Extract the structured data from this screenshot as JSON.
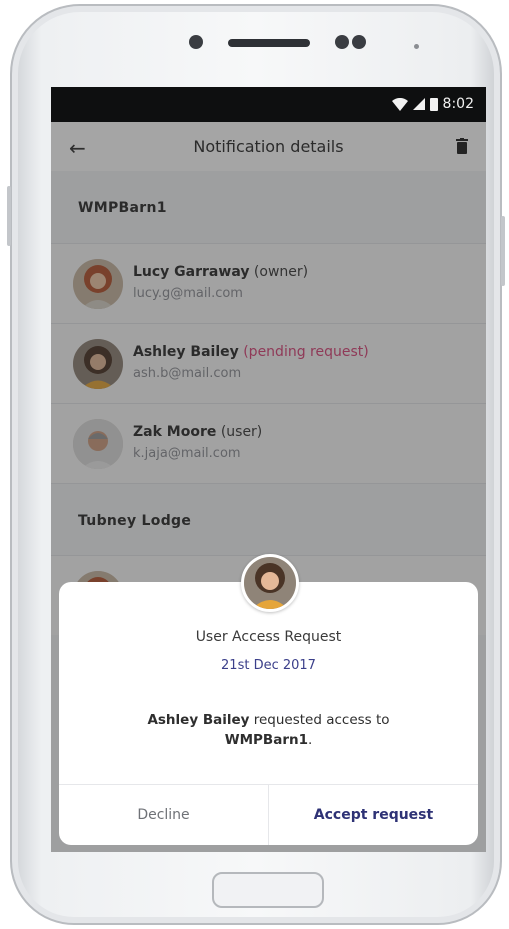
{
  "statusbar": {
    "time": "8:02"
  },
  "appbar": {
    "title": "Notification details"
  },
  "sections": [
    {
      "name": "WMPBarn1",
      "users": [
        {
          "name": "Lucy Garraway",
          "role": "(owner)",
          "email": "lucy.g@mail.com",
          "pending": false
        },
        {
          "name": "Ashley Bailey",
          "role": "(pending request)",
          "email": "ash.b@mail.com",
          "pending": true
        },
        {
          "name": "Zak Moore",
          "role": "(user)",
          "email": "k.jaja@mail.com",
          "pending": false
        }
      ]
    },
    {
      "name": "Tubney Lodge",
      "users": []
    }
  ],
  "modal": {
    "title": "User Access Request",
    "date": "21st Dec 2017",
    "requester": "Ashley Bailey",
    "message": "requested access to",
    "property": "WMPBarn1",
    "decline_label": "Decline",
    "accept_label": "Accept request"
  },
  "colors": {
    "accent": "#2e3275",
    "pending": "#d9477a",
    "date": "#3b3f8a"
  }
}
